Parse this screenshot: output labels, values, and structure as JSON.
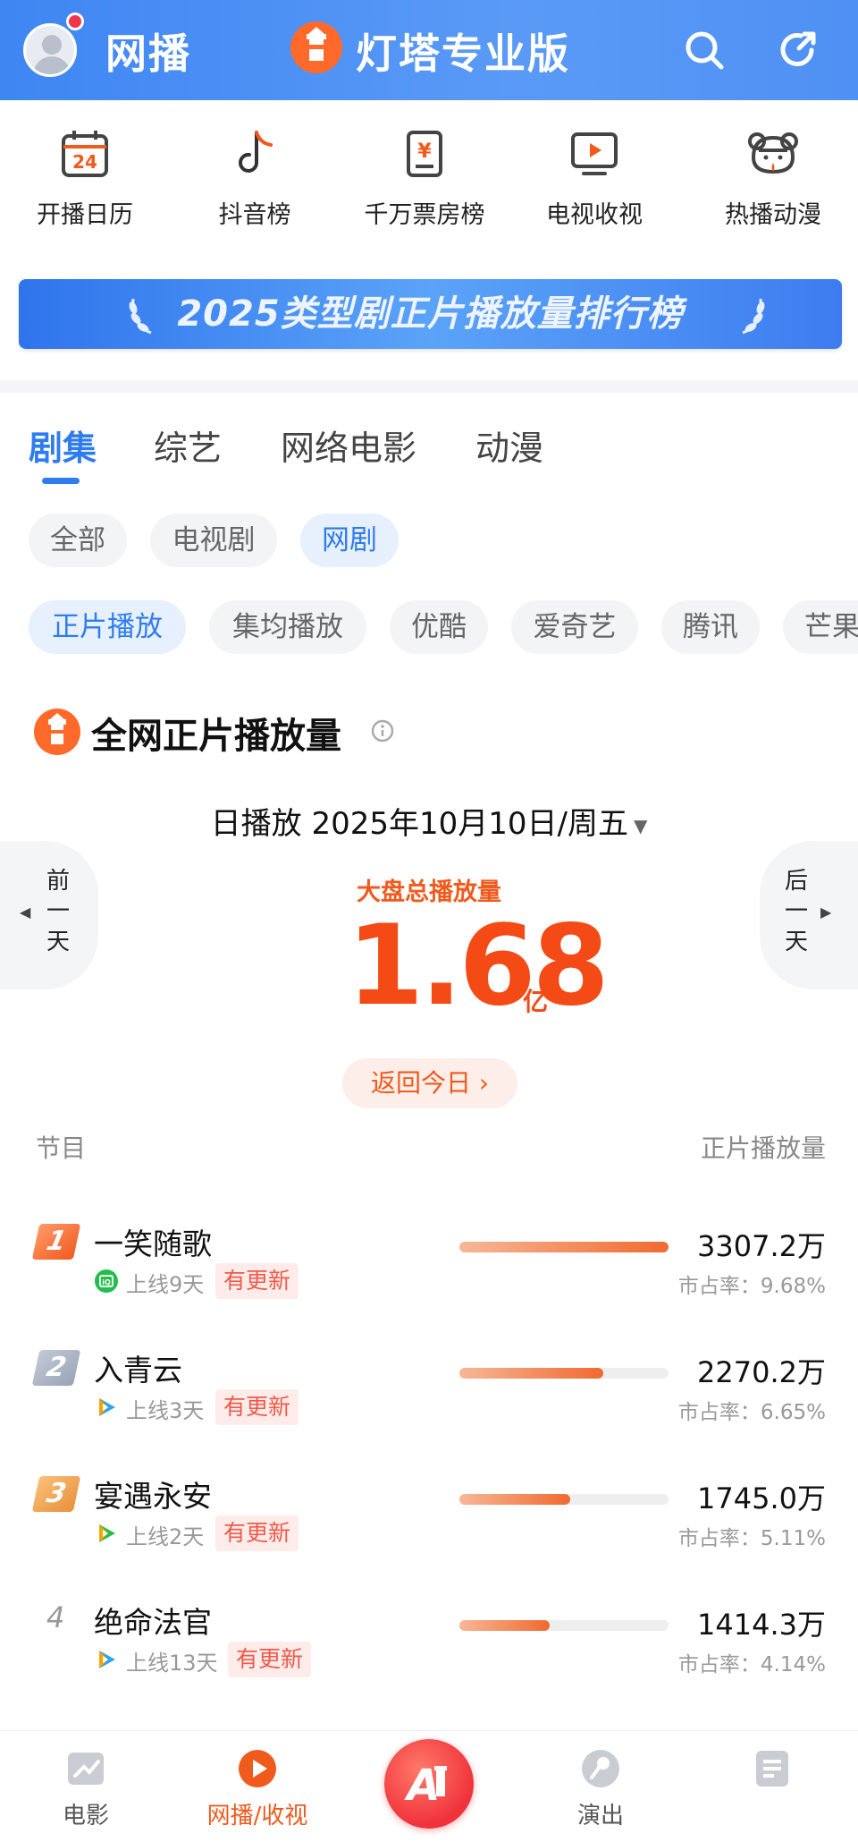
{
  "header": {
    "title": "网播",
    "brand": "灯塔专业版"
  },
  "quick_menu": [
    {
      "label": "开播日历",
      "icon": "calendar-icon"
    },
    {
      "label": "抖音榜",
      "icon": "tiktok-icon"
    },
    {
      "label": "千万票房榜",
      "icon": "ticket-yen-icon"
    },
    {
      "label": "电视收视",
      "icon": "tv-icon"
    },
    {
      "label": "热播动漫",
      "icon": "anime-icon"
    }
  ],
  "banner": {
    "text": "2025类型剧正片播放量排行榜"
  },
  "tabs": [
    "剧集",
    "综艺",
    "网络电影",
    "动漫"
  ],
  "type_filters": [
    "全部",
    "电视剧",
    "网剧"
  ],
  "metric_filters": [
    "正片播放",
    "集均播放",
    "优酷",
    "爱奇艺",
    "腾讯",
    "芒果"
  ],
  "section": {
    "title": "全网正片播放量",
    "date_label": "日播放 2025年10月10日/周五",
    "prev_day": "前一天",
    "next_day": "后一天",
    "total_label": "大盘总播放量",
    "total_value": "1.68",
    "total_unit": "亿",
    "back_today": "返回今日 ›",
    "col_program": "节目",
    "col_views": "正片播放量"
  },
  "rows": [
    {
      "rank": "1",
      "name": "一笑随歌",
      "platform": "iqiyi-icon",
      "online": "上线9天",
      "tag": "有更新",
      "amount": "3307.2万",
      "share": "市占率：9.68%",
      "ratio": 1.0
    },
    {
      "rank": "2",
      "name": "入青云",
      "platform": "tencent-video-icon",
      "online": "上线3天",
      "tag": "有更新",
      "amount": "2270.2万",
      "share": "市占率：6.65%",
      "ratio": 0.69
    },
    {
      "rank": "3",
      "name": "宴遇永安",
      "platform": "tencent-video-icon",
      "online": "上线2天",
      "tag": "有更新",
      "amount": "1745.0万",
      "share": "市占率：5.11%",
      "ratio": 0.53
    },
    {
      "rank": "4",
      "name": "绝命法官",
      "platform": "tencent-video-icon",
      "online": "上线13天",
      "tag": "有更新",
      "amount": "1414.3万",
      "share": "市占率：4.14%",
      "ratio": 0.43
    }
  ],
  "bottom_nav": [
    {
      "label": "电影",
      "icon": "film-icon"
    },
    {
      "label": "网播/收视",
      "icon": "play-icon"
    },
    {
      "label": "演出",
      "icon": "microphone-icon"
    },
    {
      "label": "",
      "icon": "document-icon"
    }
  ],
  "colors": {
    "accent": "#2f7cf0",
    "orange": "#f44a16",
    "header": "#4a8ff5"
  }
}
